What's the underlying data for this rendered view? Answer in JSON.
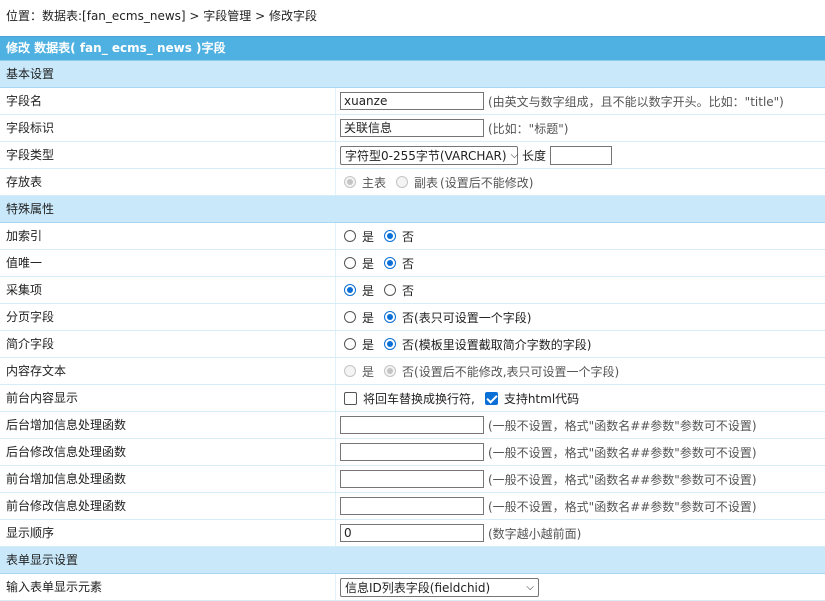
{
  "breadcrumb": {
    "prefix": "位置：数据表:",
    "table": "[fan_ecms_news]",
    "sep1": " > ",
    "field_mgmt": "字段管理",
    "sep2": " > ",
    "current": "修改字段"
  },
  "header": {
    "title": "修改 数据表( fan_ ecms_ news )字段"
  },
  "sections": {
    "basic": "基本设置",
    "special": "特殊属性",
    "form_display": "表单显示设置"
  },
  "rows": {
    "field_name": {
      "label": "字段名",
      "value": "xuanze",
      "hint": "(由英文与数字组成，且不能以数字开头。比如：\"title\")"
    },
    "field_title": {
      "label": "字段标识",
      "value": "关联信息",
      "hint": "(比如：\"标题\")"
    },
    "field_type": {
      "label": "字段类型",
      "selected": "字符型0-255字节(VARCHAR)",
      "length_label": "长度",
      "length_value": ""
    },
    "store_table": {
      "label": "存放表",
      "opt1": "主表",
      "opt2": "副表",
      "note": "(设置后不能修改)"
    },
    "add_index": {
      "label": "加索引",
      "yes": "是",
      "no": "否"
    },
    "unique": {
      "label": "值唯一",
      "yes": "是",
      "no": "否"
    },
    "collect": {
      "label": "采集项",
      "yes": "是",
      "no": "否"
    },
    "page_field": {
      "label": "分页字段",
      "yes": "是",
      "no": "否(表只可设置一个字段)"
    },
    "intro_field": {
      "label": "简介字段",
      "yes": "是",
      "no": "否(模板里设置截取简介字数的字段)"
    },
    "content_text": {
      "label": "内容存文本",
      "yes": "是",
      "no": "否(设置后不能修改,表只可设置一个字段)"
    },
    "front_display": {
      "label": "前台内容显示",
      "opt1": "将回车替换成换行符,",
      "opt2": "支持html代码"
    },
    "back_add_func": {
      "label": "后台增加信息处理函数",
      "value": "",
      "hint": "(一般不设置，格式\"函数名##参数\"参数可不设置)"
    },
    "back_edit_func": {
      "label": "后台修改信息处理函数",
      "value": "",
      "hint": "(一般不设置，格式\"函数名##参数\"参数可不设置)"
    },
    "front_add_func": {
      "label": "前台增加信息处理函数",
      "value": "",
      "hint": "(一般不设置，格式\"函数名##参数\"参数可不设置)"
    },
    "front_edit_func": {
      "label": "前台修改信息处理函数",
      "value": "",
      "hint": "(一般不设置，格式\"函数名##参数\"参数可不设置)"
    },
    "order": {
      "label": "显示顺序",
      "value": "0",
      "hint": "(数字越小越前面)"
    },
    "input_element": {
      "label": "输入表单显示元素",
      "selected": "信息ID列表字段(fieldchid)"
    }
  },
  "colors": {
    "header_bg": "#4fb1e1",
    "section_bg": "#c9e9fb",
    "accent": "#0a6fd6"
  }
}
